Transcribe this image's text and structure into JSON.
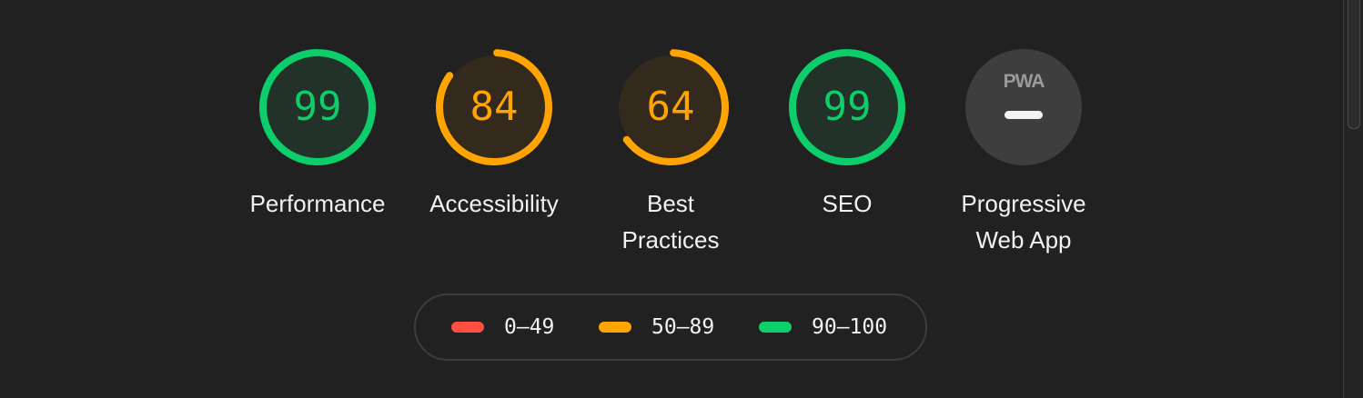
{
  "gauges": [
    {
      "key": "performance",
      "score": "99",
      "value": 99,
      "label": "Performance",
      "color": "#0cce6b",
      "fill": "#233229",
      "text_color": "#0cce6b"
    },
    {
      "key": "accessibility",
      "score": "84",
      "value": 84,
      "label": "Accessibility",
      "color": "#ffa400",
      "fill": "#33291c",
      "text_color": "#ffa400"
    },
    {
      "key": "best-practices",
      "score": "64",
      "value": 64,
      "label": "Best\nPractices",
      "color": "#ffa400",
      "fill": "#33291c",
      "text_color": "#ffa400"
    },
    {
      "key": "seo",
      "score": "99",
      "value": 99,
      "label": "SEO",
      "color": "#0cce6b",
      "fill": "#233229",
      "text_color": "#0cce6b"
    }
  ],
  "pwa": {
    "badge_text": "PWA",
    "label": "Progressive\nWeb App",
    "fill": "#3e3e3e"
  },
  "legend": [
    {
      "range": "0–49",
      "color": "#ff4e42"
    },
    {
      "range": "50–89",
      "color": "#ffa400"
    },
    {
      "range": "90–100",
      "color": "#0cce6b"
    }
  ]
}
